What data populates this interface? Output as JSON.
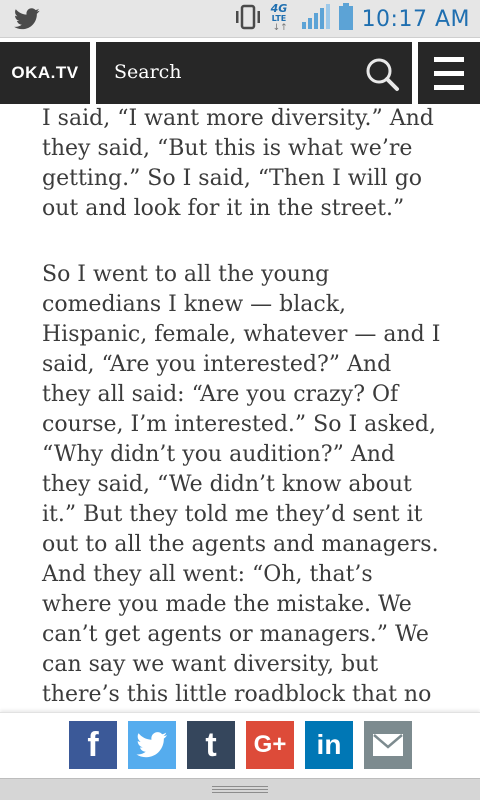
{
  "status_bar": {
    "time": "10:17 AM",
    "network_type_top": "4G",
    "network_type_bottom": "LTE",
    "icons": [
      "twitter-icon",
      "vibrate-icon",
      "lte-icon",
      "signal-icon",
      "battery-icon"
    ]
  },
  "header": {
    "logo": "OKA.TV",
    "search_placeholder": "Search",
    "icons": [
      "search-icon",
      "menu-icon"
    ]
  },
  "article": {
    "paragraphs": [
      "I said, “I want more diversity.” And they said, “But this is what we’re getting.” So I said, “Then I will go out and look for it in the street.”",
      "So I went to all the young comedians I knew — black, Hispanic, female, whatever — and I said, “Are you interested?” And they all said: “Are you crazy? Of course, I’m interested.” So I asked, “Why didn’t you audition?” And they said, “We didn’t know about it.” But they told me they’d sent it out to all the agents and managers. And they all went: “Oh, that’s where you made the mistake. We can’t get agents or managers.” We can say we want diversity, but there’s this little roadblock that no"
    ]
  },
  "share_bar": {
    "buttons": [
      {
        "name": "facebook",
        "icon": "facebook-icon",
        "glyph": "f",
        "color": "#3b5998"
      },
      {
        "name": "twitter",
        "icon": "twitter-icon",
        "glyph": "",
        "color": "#55acee"
      },
      {
        "name": "tumblr",
        "icon": "tumblr-icon",
        "glyph": "t",
        "color": "#35465c"
      },
      {
        "name": "google-plus",
        "icon": "google-plus-icon",
        "glyph": "G+",
        "color": "#dd4b39"
      },
      {
        "name": "linkedin",
        "icon": "linkedin-icon",
        "glyph": "in",
        "color": "#0077b5"
      },
      {
        "name": "email",
        "icon": "email-icon",
        "glyph": "",
        "color": "#7d8b8f"
      }
    ]
  }
}
